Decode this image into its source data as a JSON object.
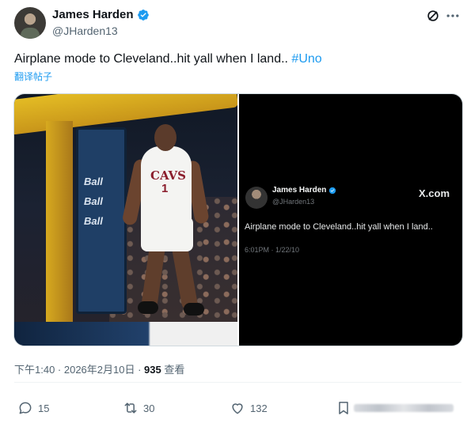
{
  "author": {
    "name": "James Harden",
    "handle": "@JHarden13"
  },
  "tweet": {
    "text": "Airplane mode to Cleveland..hit yall when I land.. ",
    "hashtag": "#Uno",
    "translate_label": "翻译帖子"
  },
  "media": {
    "left": {
      "jersey_word": "CAVS",
      "jersey_number": "1",
      "pad_logo": "Ball"
    },
    "right": {
      "name": "James Harden",
      "handle": "@JHarden13",
      "brand": "X.com",
      "text": "Airplane mode to Cleveland..hit yall when I land..",
      "timestamp": "6:01PM · 1/22/10"
    }
  },
  "meta": {
    "time_date": "下午1:40 · 2026年2月10日 · ",
    "views_count": "935",
    "views_label": " 查看"
  },
  "actions": {
    "replies": "15",
    "reposts": "30",
    "likes": "132"
  },
  "icons": {
    "verified": "verified-badge-icon",
    "grok": "grok-icon",
    "more": "more-icon",
    "reply": "reply-icon",
    "repost": "repost-icon",
    "like": "like-icon",
    "bookmark": "bookmark-icon"
  },
  "colors": {
    "link": "#1d9bf0",
    "secondary_text": "#536471",
    "primary_text": "#0f1419"
  }
}
